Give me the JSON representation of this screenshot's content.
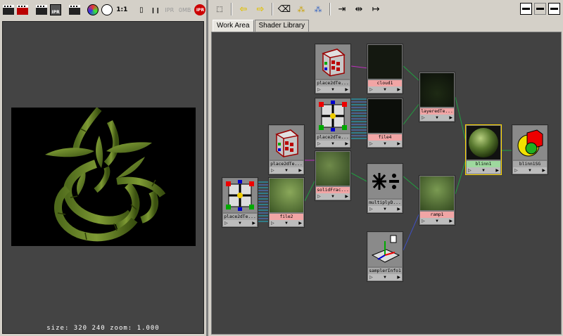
{
  "render_view": {
    "toolbar": {
      "ratio_label": "1:1",
      "pause_icon": "❙❙",
      "ipr_label": "IPR",
      "mem_label": "0MB",
      "ipr_button_label": "IPR"
    },
    "status_text": "size:  320  240 zoom: 1.000"
  },
  "hypershade": {
    "tabs": [
      "Work Area",
      "Shader Library"
    ],
    "active_tab": "Work Area",
    "nodes": [
      {
        "id": "n_place2d_top",
        "label": "place2dTe...",
        "type": "place3d",
        "label_color": "gray"
      },
      {
        "id": "n_cloud1",
        "label": "cloud1",
        "type": "texture",
        "label_color": "pink"
      },
      {
        "id": "n_layered",
        "label": "layeredTe...",
        "type": "texture",
        "label_color": "pink"
      },
      {
        "id": "n_place2d_mid",
        "label": "place2dTe...",
        "type": "place2d",
        "label_color": "gray"
      },
      {
        "id": "n_file4",
        "label": "file4",
        "type": "texture",
        "label_color": "pink"
      },
      {
        "id": "n_place2d_left",
        "label": "place2dTe...",
        "type": "place3d",
        "label_color": "gray"
      },
      {
        "id": "n_solidfrac",
        "label": "solidFrac...",
        "type": "texture",
        "label_color": "pink"
      },
      {
        "id": "n_blinn1",
        "label": "blinn1",
        "type": "shader",
        "label_color": "green"
      },
      {
        "id": "n_blinn1sg",
        "label": "blinn1SG",
        "type": "sg",
        "label_color": "gray"
      },
      {
        "id": "n_place2d_low",
        "label": "place2dTe...",
        "type": "place2d",
        "label_color": "gray"
      },
      {
        "id": "n_file2",
        "label": "file2",
        "type": "texture",
        "label_color": "pink"
      },
      {
        "id": "n_multiply",
        "label": "multiplyD...",
        "type": "utility",
        "label_color": "gray"
      },
      {
        "id": "n_ramp1",
        "label": "ramp1",
        "type": "texture",
        "label_color": "pink"
      },
      {
        "id": "n_sampler",
        "label": "samplerInfo1",
        "type": "sampler",
        "label_color": "gray"
      }
    ]
  },
  "icons": {
    "port_left": "▷",
    "port_mid": "▼",
    "port_right": "▶"
  }
}
